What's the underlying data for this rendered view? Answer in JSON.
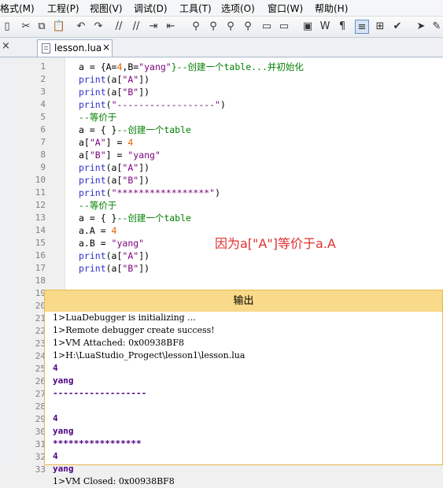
{
  "menu": [
    "格式(M)",
    "工程(P)",
    "视图(V)",
    "调试(D)",
    "工具(T)",
    "选项(O)",
    "窗口(W)",
    "帮助(H)"
  ],
  "tab": {
    "label": "lesson.lua",
    "close": "×"
  },
  "panel_close": "×",
  "line_numbers": [
    "1",
    "2",
    "3",
    "4",
    "5",
    "6",
    "7",
    "8",
    "9",
    "10",
    "11",
    "12",
    "13",
    "14",
    "15",
    "16",
    "17",
    "18",
    "19",
    "20",
    "21",
    "22",
    "23",
    "24",
    "25",
    "26",
    "27",
    "28",
    "29",
    "30",
    "31",
    "32",
    "33"
  ],
  "code": [
    [
      [
        "a = {A=",
        "t"
      ],
      [
        "4",
        "n"
      ],
      [
        ",B=",
        "t"
      ],
      [
        "\"yang\"",
        "s"
      ],
      [
        "}--创建一个table...并初始化",
        "c"
      ]
    ],
    [
      [
        "print",
        "k"
      ],
      [
        "(a[",
        "t"
      ],
      [
        "\"A\"",
        "s"
      ],
      [
        "])",
        "t"
      ]
    ],
    [
      [
        "print",
        "k"
      ],
      [
        "(a[",
        "t"
      ],
      [
        "\"B\"",
        "s"
      ],
      [
        "])",
        "t"
      ]
    ],
    [
      [
        "print",
        "k"
      ],
      [
        "(",
        "t"
      ],
      [
        "\"------------------\"",
        "s"
      ],
      [
        ")",
        "t"
      ]
    ],
    [
      [
        "--等价于",
        "c"
      ]
    ],
    [
      [
        "a = { }",
        "t"
      ],
      [
        "--创建一个table",
        "c"
      ]
    ],
    [
      [
        "a[",
        "t"
      ],
      [
        "\"A\"",
        "s"
      ],
      [
        "] = ",
        "t"
      ],
      [
        "4",
        "n"
      ]
    ],
    [
      [
        "a[",
        "t"
      ],
      [
        "\"B\"",
        "s"
      ],
      [
        "] = ",
        "t"
      ],
      [
        "\"yang\"",
        "s"
      ]
    ],
    [
      [
        "print",
        "k"
      ],
      [
        "(a[",
        "t"
      ],
      [
        "\"A\"",
        "s"
      ],
      [
        "])",
        "t"
      ]
    ],
    [
      [
        "print",
        "k"
      ],
      [
        "(a[",
        "t"
      ],
      [
        "\"B\"",
        "s"
      ],
      [
        "])",
        "t"
      ]
    ],
    [
      [
        "print",
        "k"
      ],
      [
        "(",
        "t"
      ],
      [
        "\"*****************\"",
        "s"
      ],
      [
        ")",
        "t"
      ]
    ],
    [
      [
        "--等价于",
        "c"
      ]
    ],
    [
      [
        "a = { }",
        "t"
      ],
      [
        "--创建一个table",
        "c"
      ]
    ],
    [
      [
        "a.A = ",
        "t"
      ],
      [
        "4",
        "n"
      ]
    ],
    [
      [
        "a.B = ",
        "t"
      ],
      [
        "\"yang\"",
        "s"
      ]
    ],
    [
      [
        "print",
        "k"
      ],
      [
        "(a[",
        "t"
      ],
      [
        "\"A\"",
        "s"
      ],
      [
        "])",
        "t"
      ]
    ],
    [
      [
        "print",
        "k"
      ],
      [
        "(a[",
        "t"
      ],
      [
        "\"B\"",
        "s"
      ],
      [
        "])",
        "t"
      ]
    ]
  ],
  "annotation": "因为a[\"A\"]等价于a.A",
  "output": {
    "title": "输出",
    "lines": [
      [
        "1>LuaDebugger is initializing ...",
        false
      ],
      [
        "1>Remote debugger create success!",
        false
      ],
      [
        "1>VM Attached: 0x00938BF8",
        false
      ],
      [
        "1>H:\\LuaStudio_Progect\\lesson1\\lesson.lua",
        false
      ],
      [
        "4",
        true
      ],
      [
        "yang",
        true
      ],
      [
        "------------------",
        true
      ],
      [
        "",
        false
      ],
      [
        "4",
        true
      ],
      [
        "yang",
        true
      ],
      [
        "*****************",
        true
      ],
      [
        "4",
        true
      ],
      [
        "yang",
        true
      ],
      [
        "1>VM Closed: 0x00938BF8",
        false
      ]
    ]
  },
  "colors": {
    "keyword": "#3030c8",
    "string": "#7a007a",
    "number": "#e06000",
    "comment": "#008000",
    "annotation": "#e03030",
    "output_title_bg": "#f9d98a"
  }
}
